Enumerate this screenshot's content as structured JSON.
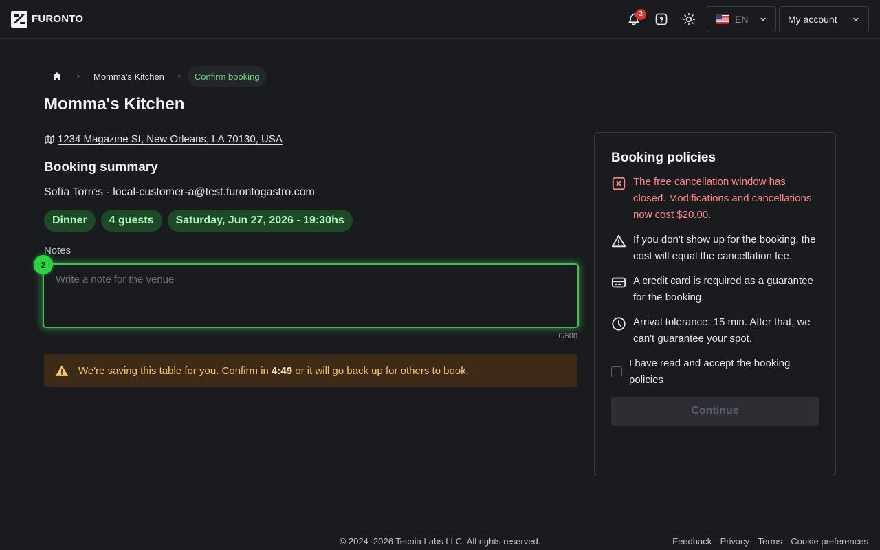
{
  "header": {
    "logo_text": "FURONTO",
    "notifications_count": "2",
    "language_code": "EN",
    "account_label": "My account",
    "icons": [
      "bell-icon",
      "help-icon",
      "sun-icon",
      "us-flag-icon",
      "chevron-down-icon"
    ]
  },
  "breadcrumb": {
    "items": [
      "Momma's Kitchen",
      "Confirm booking"
    ]
  },
  "venue": {
    "name": "Momma's Kitchen",
    "address": "1234 Magazine St, New Orleans, LA 70130, USA"
  },
  "summary": {
    "title": "Booking summary",
    "customer_line": "Sofía Torres - local-customer-a@test.furontogastro.com",
    "chips": [
      "Dinner",
      "4 guests",
      "Saturday, Jun 27, 2026 - 19:30hs"
    ]
  },
  "notes": {
    "label": "Notes",
    "placeholder": "Write a note for the venue",
    "value": "",
    "char_count": "0/500",
    "step_badge": "2"
  },
  "hold_alert": {
    "before": "We're saving this table for you. Confirm in ",
    "time": "4:49",
    "after": " or it will go back up for others to book."
  },
  "policies": {
    "title": "Booking policies",
    "items": [
      {
        "icon": "x-square-icon",
        "text": "The free cancellation window has closed. Modifications and cancellations now cost $20.00."
      },
      {
        "icon": "alert-triangle-icon",
        "text": "If you don't show up for the booking, the cost will equal the cancellation fee."
      },
      {
        "icon": "credit-card-icon",
        "text": "A credit card is required as a guarantee for the booking."
      },
      {
        "icon": "clock-icon",
        "text": "Arrival tolerance: 15 min. After that, we can't guarantee your spot."
      }
    ],
    "accept_label": "I have read and accept the booking policies",
    "accepted": false,
    "continue_label": "Continue"
  },
  "footer": {
    "copyright": "© 2024–2026 Tecnia Labs LLC. All rights reserved.",
    "links": [
      "Feedback",
      "Privacy",
      "Terms",
      "Cookie preferences"
    ],
    "separator": "-"
  },
  "colors": {
    "accent_green": "#40c057",
    "danger": "#ff8787",
    "warning_text": "#fcc46e",
    "background": "#1a1b1e"
  }
}
